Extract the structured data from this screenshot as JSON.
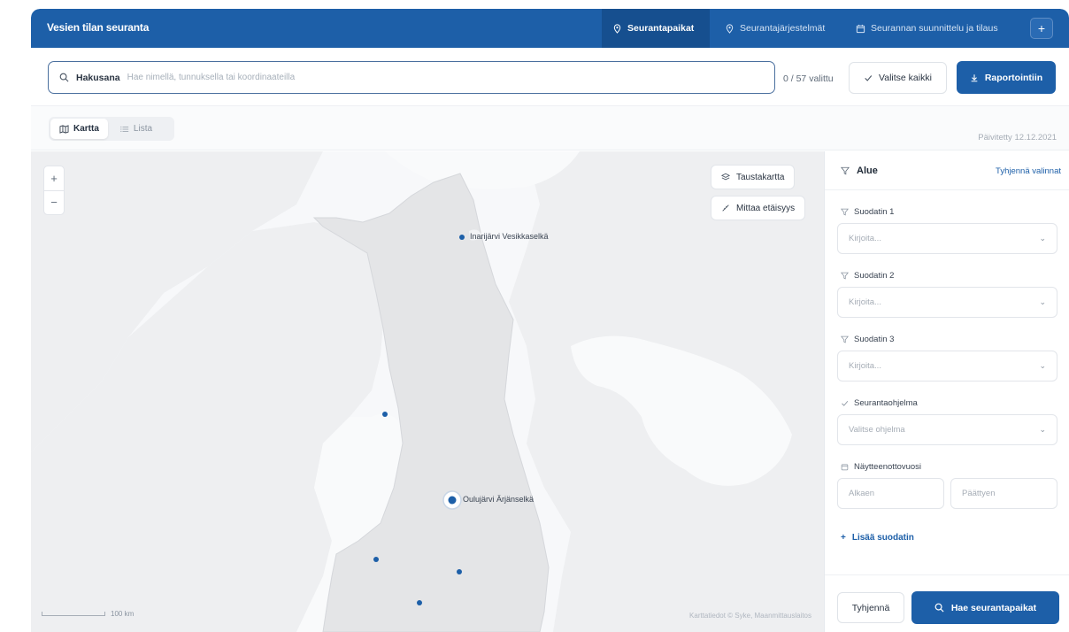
{
  "app": {
    "title": "Vesien tilan seuranta"
  },
  "nav": {
    "tabs": [
      {
        "label": "Seurantapaikat",
        "icon": "map-pin-icon",
        "active": true
      },
      {
        "label": "Seurantajärjestelmät",
        "icon": "map-pin-icon",
        "active": false
      },
      {
        "label": "Seurannan suunnittelu ja tilaus",
        "icon": "calendar-icon",
        "active": false
      }
    ],
    "plus_label": "+"
  },
  "search": {
    "label": "Hakusana",
    "placeholder": "Hae nimellä, tunnuksella tai koordinaateilla",
    "selected_count": "0 / 57 valittu",
    "select_all_label": "Valitse kaikki",
    "report_label": "Raportointiin"
  },
  "view": {
    "map_label": "Kartta",
    "list_label": "Lista",
    "active": "map",
    "updated_text": "Päivitetty 12.12.2021"
  },
  "map": {
    "zoom_in": "+",
    "zoom_out": "−",
    "basemap_label": "Taustakartta",
    "measure_label": "Mittaa etäisyys",
    "scale_label": "100 km",
    "attribution": "Karttatiedot © Syke, Maanmittauslaitos",
    "sites": [
      {
        "name": "Inarijärvi Vesikkaselkä"
      },
      {
        "name": "Oulujärvi Ärjänselkä"
      }
    ]
  },
  "filters": {
    "title": "Alue",
    "clear_label": "Tyhjennä valinnat",
    "filter1_label": "Suodatin 1",
    "filter1_placeholder": "Kirjoita...",
    "filter2_label": "Suodatin 2",
    "filter2_placeholder": "Kirjoita...",
    "filter3_label": "Suodatin 3",
    "filter3_placeholder": "Kirjoita...",
    "program_label": "Seurantaohjelma",
    "program_placeholder": "Valitse ohjelma",
    "year_label": "Näytteenottovuosi",
    "year_start": "Alkaen",
    "year_end": "Päättyen",
    "add_filter_label": "Lisää suodatin",
    "reset_label": "Tyhjennä",
    "search_label": "Hae seurantapaikat"
  },
  "colors": {
    "primary": "#1d5fa8",
    "header_active": "#164f8f",
    "land_finland": "#e4e5e7",
    "land_other": "#eeeff1",
    "water": "#f9fafb"
  }
}
